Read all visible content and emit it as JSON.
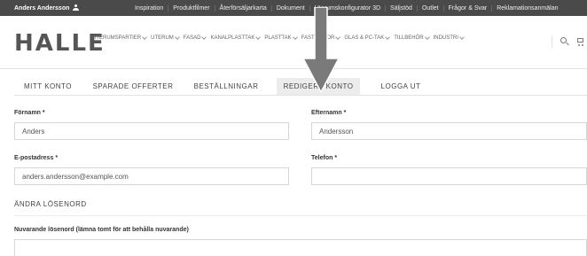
{
  "topbar": {
    "user_name": "Anders Andersson",
    "links": [
      "Inspiration",
      "Produktfilmer",
      "Återförsäljarkarta",
      "Dokument",
      "Uterumskonfigurator 3D",
      "Säljstöd",
      "Outlet",
      "Frågor & Svar",
      "Reklamationsanmälan"
    ]
  },
  "header": {
    "logo": "HALLE",
    "nav": [
      "UTERUMSPARTIER",
      "UTERUM",
      "FASAD",
      "KANALPLASTTAK",
      "PLASTTAK",
      "FASTSKIVOR",
      "GLAS & PC-TAK",
      "TILLBEHÖR",
      "INDUSTRI"
    ]
  },
  "tabs": {
    "items": [
      "MITT KONTO",
      "SPARADE OFFERTER",
      "BESTÄLLNINGAR",
      "REDIGERA KONTO",
      "LOGGA UT"
    ],
    "active": "REDIGERA KONTO"
  },
  "form": {
    "first_name_label": "Förnamn",
    "first_name_value": "Anders",
    "last_name_label": "Efternamn",
    "last_name_value": "Andersson",
    "email_label": "E-postadress",
    "email_value": "anders.andersson@example.com",
    "phone_label": "Telefon",
    "phone_value": "",
    "required_mark": "*",
    "password_section": "ÄNDRA LÖSENORD",
    "current_password_label": "Nuvarande lösenord (lämna tomt för att behålla nuvarande)",
    "current_password_value": ""
  },
  "colors": {
    "topbar_bg": "#4a4a4a",
    "active_tab_bg": "#ececec",
    "arrow_fill": "#7a7a7a"
  }
}
